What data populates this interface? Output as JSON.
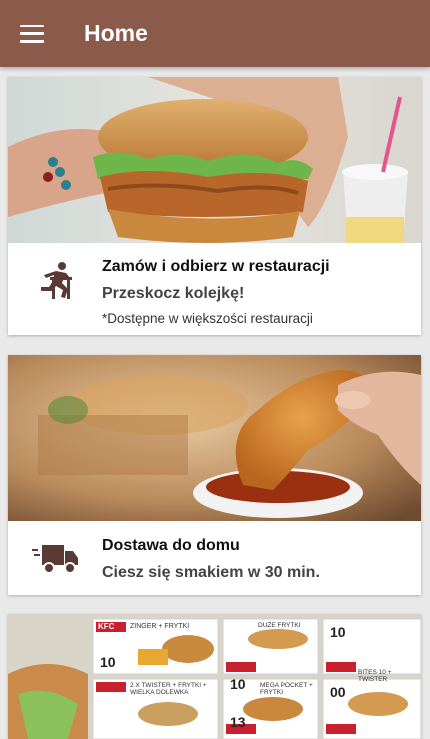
{
  "appbar": {
    "title": "Home",
    "menu_icon": "hamburger-menu-icon"
  },
  "colors": {
    "appbar": "#8b5a4b",
    "icon": "#5b3a33",
    "background": "#e9e9e9"
  },
  "cards": [
    {
      "image": "burger-in-hands-photo",
      "icon": "jumping-person-icon",
      "title": "Zamów i odbierz w restauracji",
      "subtitle": "Przeskocz kolejkę!",
      "note": "*Dostępne w większości restauracji"
    },
    {
      "image": "chicken-drumstick-dip-photo",
      "icon": "delivery-truck-icon",
      "title": "Dostawa do domu",
      "subtitle": "Ciesz się smakiem w 30 min."
    },
    {
      "image": "kfc-coupons-photo",
      "coupons": {
        "brand": "KFC",
        "items": [
          "ZINGER + FRYTKI",
          "2 X TWISTER + FRYTKI + WIELKA DOLEWKA",
          "MEGA POCKET + FRYTKI",
          "DUŻE FRYTKI",
          "BITES 10 + TWISTER"
        ],
        "prices": [
          "10",
          "13",
          "10",
          "10",
          "00"
        ]
      }
    }
  ]
}
